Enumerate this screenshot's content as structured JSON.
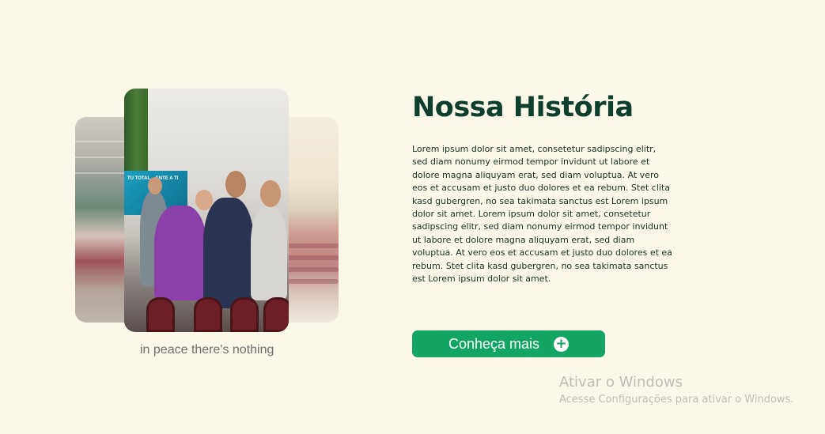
{
  "gallery": {
    "caption": "in peace there's nothing",
    "screen_text": "TU TOTAL... ENTE A TI"
  },
  "about": {
    "title": "Nossa História",
    "body": "Lorem ipsum dolor sit amet, consetetur sadipscing elitr, sed diam nonumy eirmod tempor invidunt ut labore et dolore magna aliquyam erat, sed diam voluptua. At vero eos et accusam et justo duo dolores et ea rebum. Stet clita kasd gubergren, no sea takimata sanctus est Lorem ipsum dolor sit amet. Lorem ipsum dolor sit amet, consetetur sadipscing elitr, sed diam nonumy eirmod tempor invidunt ut labore et dolore magna aliquyam erat, sed diam voluptua. At vero eos et accusam et justo duo dolores et ea rebum. Stet clita kasd gubergren, no sea takimata sanctus est Lorem ipsum dolor sit amet.",
    "button_label": "Conheça mais",
    "button_icon": "plus-circle-icon"
  },
  "watermark": {
    "title": "Ativar o Windows",
    "subtitle": "Acesse Configurações para ativar o Windows."
  },
  "colors": {
    "background": "#fbf8ea",
    "title": "#0f3d2e",
    "accent": "#14a463"
  }
}
